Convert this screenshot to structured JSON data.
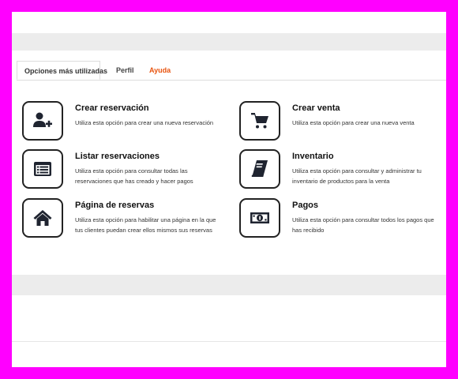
{
  "tabs": [
    {
      "label": "Opciones más utilizadas",
      "active": true
    },
    {
      "label": "Perfil",
      "active": false
    },
    {
      "label": "Ayuda",
      "active": false
    }
  ],
  "options": [
    {
      "title": "Crear reservación",
      "description": "Utiliza esta opción para crear una nueva reservación",
      "icon": "add-user-icon"
    },
    {
      "title": "Crear venta",
      "description": "Utiliza esta opción para crear una nueva venta",
      "icon": "shopping-cart-icon"
    },
    {
      "title": "Listar reservaciones",
      "description": "Utiliza esta opción para consultar todas las reservaciones que has creado y hacer pagos",
      "icon": "list-icon"
    },
    {
      "title": "Inventario",
      "description": "Utiliza esta opción para consultar y administrar tu inventario de productos para la venta",
      "icon": "book-icon"
    },
    {
      "title": "Página de reservas",
      "description": "Utiliza esta opción para habilitar una página en la que tus clientes puedan crear ellos mismos sus reservas",
      "icon": "home-icon"
    },
    {
      "title": "Pagos",
      "description": "Utiliza esta opción para consultar todos los pagos que has recibido",
      "icon": "money-bill-icon"
    }
  ],
  "colors": {
    "accent": "#e8530e",
    "frame": "#ff00ff",
    "icon": "#1f2430"
  }
}
